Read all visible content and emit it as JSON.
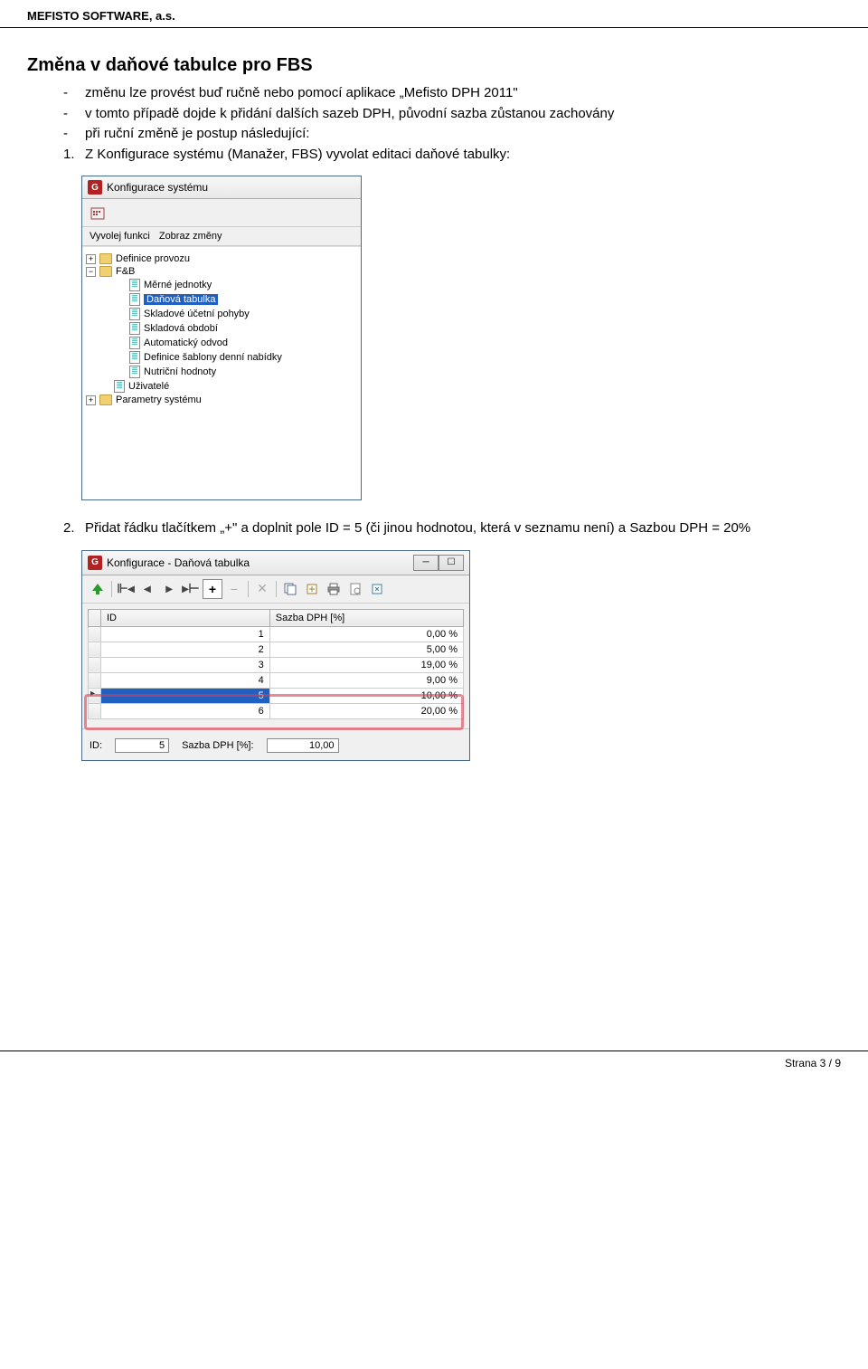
{
  "header": {
    "text": "MEFISTO SOFTWARE, a.s."
  },
  "main": {
    "heading": "Změna v daňové tabulce pro FBS",
    "bullets": [
      "změnu lze provést buď ručně nebo pomocí aplikace „Mefisto DPH 2011\"",
      "v tomto případě dojde k přidání dalších sazeb DPH, původní sazba zůstanou zachovány",
      "při ruční změně je postup následující:"
    ],
    "step1_num": "1.",
    "step1_text": "Z Konfigurace systému (Manažer, FBS) vyvolat editaci daňové tabulky:",
    "step2_num": "2.",
    "step2_text": "Přidat řádku tlačítkem „+\" a doplnit pole ID = 5 (či jinou hodnotou, která v seznamu není) a Sazbou DPH = 20%"
  },
  "win1": {
    "title": "Konfigurace systému",
    "menu": {
      "vyvolej": "Vyvolej funkci",
      "zobraz": "Zobraz změny"
    },
    "tree": {
      "definice_provozu": "Definice provozu",
      "fnb": "F&B",
      "merne_jednotky": "Měrné jednotky",
      "danova_tabulka": "Daňová tabulka",
      "skladove_pohyby": "Skladové účetní pohyby",
      "skladova_obdobi": "Skladová období",
      "automaticky_odvod": "Automatický odvod",
      "definice_sablony": "Definice šablony denní nabídky",
      "nutricni_hodnoty": "Nutriční hodnoty",
      "uzivatele": "Uživatelé",
      "parametry_systemu": "Parametry systému"
    }
  },
  "win2": {
    "title": "Konfigurace - Daňová tabulka",
    "col_id": "ID",
    "col_sazba": "Sazba DPH [%]",
    "rows": [
      {
        "id": "1",
        "rate": "0,00 %"
      },
      {
        "id": "2",
        "rate": "5,00 %"
      },
      {
        "id": "3",
        "rate": "19,00 %"
      },
      {
        "id": "4",
        "rate": "9,00 %"
      },
      {
        "id": "5",
        "rate": "10,00 %"
      },
      {
        "id": "6",
        "rate": "20,00 %"
      }
    ],
    "form": {
      "id_label": "ID:",
      "id_value": "5",
      "sazba_label": "Sazba DPH [%]:",
      "sazba_value": "10,00"
    }
  },
  "footer": {
    "text": "Strana 3 / 9"
  }
}
